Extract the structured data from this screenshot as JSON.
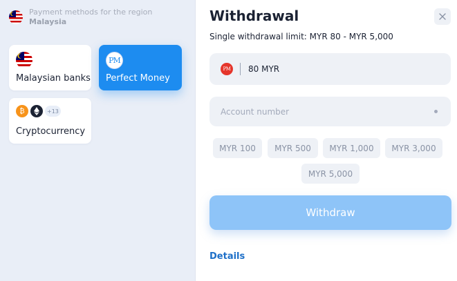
{
  "region": {
    "caption": "Payment methods for the region",
    "name": "Malaysia",
    "flag_icon": "malaysia-flag-icon"
  },
  "methods": [
    {
      "label": "Malaysian banks",
      "icon": "malaysia-flag-icon",
      "selected": false
    },
    {
      "label": "Perfect Money",
      "icon": "perfect-money-icon",
      "logo_text": "PM",
      "selected": true
    },
    {
      "label": "Cryptocurrency",
      "icon": "crypto-icons",
      "extra_count": "+13",
      "selected": false
    }
  ],
  "withdrawal": {
    "title": "Withdrawal",
    "limit_label": "Single withdrawal limit:",
    "limit_value": "MYR 80 - MYR 5,000",
    "amount_value": "80 MYR",
    "amount_icon_text": "PM",
    "account_placeholder": "Account number",
    "quick_amounts": [
      "MYR 100",
      "MYR 500",
      "MYR 1,000",
      "MYR 3,000",
      "MYR 5,000"
    ],
    "withdraw_label": "Withdraw",
    "details_label": "Details",
    "close_icon": "close-icon"
  },
  "colors": {
    "accent": "#1d8cf0",
    "withdraw_button": "#8ec4f8",
    "left_panel_bg": "#e9eef7",
    "details_link": "#1d6fc8"
  }
}
